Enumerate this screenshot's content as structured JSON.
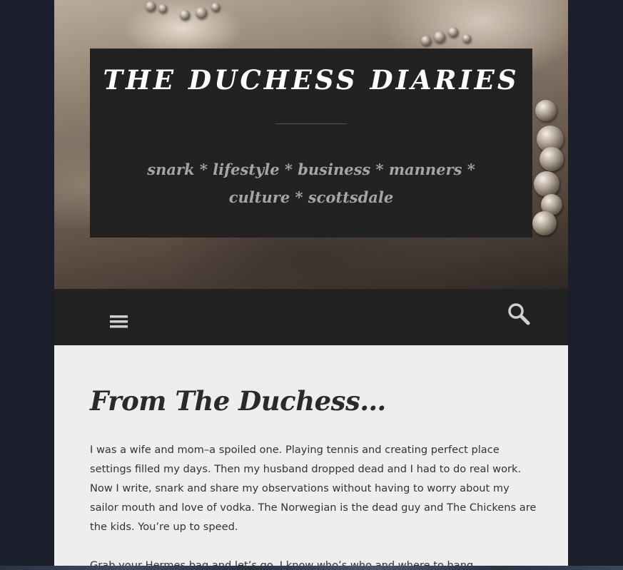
{
  "site": {
    "title": "THE DUCHESS DIARIES",
    "tagline": "snark * lifestyle * business * manners * culture * scottsdale"
  },
  "nav": {
    "menu_icon": "hamburger-menu-icon",
    "search_icon": "search-icon"
  },
  "post": {
    "title": "From The Duchess…",
    "paragraphs": [
      "I was a wife and mom–a spoiled one. Playing tennis and creating perfect place settings filled my days. Then my husband dropped dead and I had to do real work. Now I write, snark and share my observations without having to worry about my sailor mouth and love of vodka. The Norwegian is the dead guy and The Chickens are the kids. You’re up to speed.",
      "Grab your Hermes bag and let’s go. I know who’s who and where to hang."
    ]
  },
  "colors": {
    "page_background": "#1b1f2b",
    "title_box": "#222222",
    "navbar": "#222222",
    "content_background": "#eeeeee",
    "title_text": "#ffffff",
    "tagline_text": "#a5a5a5",
    "body_text": "#333333"
  }
}
